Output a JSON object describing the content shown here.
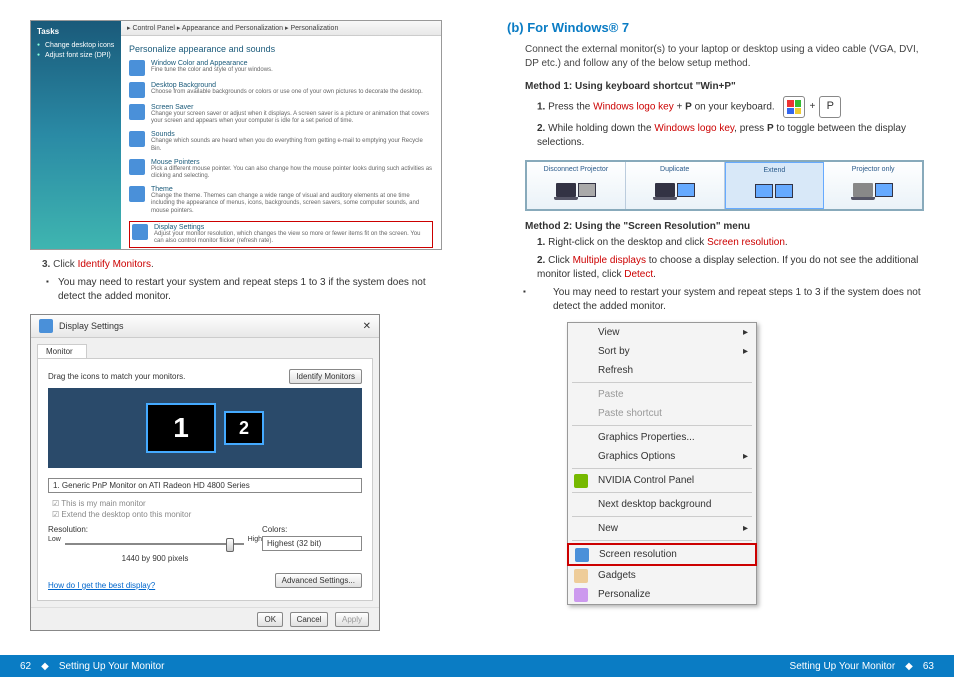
{
  "pages": {
    "left_num": "62",
    "right_num": "63",
    "section": "Setting Up Your Monitor"
  },
  "left": {
    "step3_label": "3.",
    "step3_pre": "Click ",
    "step3_link": "Identify Monitors",
    "step3_post": ".",
    "note": "You may need to restart your system and repeat steps 1 to 3 if the system does not detect the added monitor."
  },
  "cpanel": {
    "crumb": "▸ Control Panel ▸ Appearance and Personalization ▸ Personalization",
    "tasks_title": "Tasks",
    "tasks": [
      "Change desktop icons",
      "Adjust font size (DPI)"
    ],
    "heading": "Personalize appearance and sounds",
    "items": [
      {
        "t": "Window Color and Appearance",
        "s": "Fine tune the color and style of your windows."
      },
      {
        "t": "Desktop Background",
        "s": "Choose from available backgrounds or colors or use one of your own pictures to decorate the desktop."
      },
      {
        "t": "Screen Saver",
        "s": "Change your screen saver or adjust when it displays. A screen saver is a picture or animation that covers your screen and appears when your computer is idle for a set period of time."
      },
      {
        "t": "Sounds",
        "s": "Change which sounds are heard when you do everything from getting e-mail to emptying your Recycle Bin."
      },
      {
        "t": "Mouse Pointers",
        "s": "Pick a different mouse pointer. You can also change how the mouse pointer looks during such activities as clicking and selecting."
      },
      {
        "t": "Theme",
        "s": "Change the theme. Themes can change a wide range of visual and auditory elements at one time including the appearance of menus, icons, backgrounds, screen savers, some computer sounds, and mouse pointers."
      },
      {
        "t": "Display Settings",
        "s": "Adjust your monitor resolution, which changes the view so more or fewer items fit on the screen. You can also control monitor flicker (refresh rate)."
      }
    ]
  },
  "dialog": {
    "title": "Display Settings",
    "tab": "Monitor",
    "instr": "Drag the icons to match your monitors.",
    "identify_btn": "Identify Monitors",
    "mon1": "1",
    "mon2": "2",
    "dropdown": "1. Generic PnP Monitor on ATI Radeon HD 4800 Series",
    "chk1": "This is my main monitor",
    "chk2": "Extend the desktop onto this monitor",
    "res_label": "Resolution:",
    "low": "Low",
    "high": "High",
    "res_val": "1440 by 900 pixels",
    "colors_label": "Colors:",
    "colors_val": "Highest (32 bit)",
    "help_link": "How do I get the best display?",
    "adv_btn": "Advanced Settings...",
    "ok": "OK",
    "cancel": "Cancel",
    "apply": "Apply"
  },
  "right": {
    "prefix": "(b)",
    "heading": "For Windows® 7",
    "intro": "Connect the external monitor(s) to your laptop or desktop using a video cable (VGA, DVI, DP etc.) and follow any of the below setup method.",
    "m1_title": "Method 1: Using keyboard shortcut \"Win+P\"",
    "m1_1a": "Press the ",
    "m1_1b": "Windows logo key",
    "m1_1c": " + ",
    "m1_1d": "P",
    "m1_1e": " on your keyboard.",
    "m1_2a": "While holding down the ",
    "m1_2b": "Windows logo key",
    "m1_2c": ", press ",
    "m1_2d": "P",
    "m1_2e": " to toggle between the display selections.",
    "proj": [
      "Disconnect Projector",
      "Duplicate",
      "Extend",
      "Projector only"
    ],
    "m2_title": "Method 2: Using the \"Screen Resolution\" menu",
    "m2_1a": "Right-click on the desktop and click ",
    "m2_1b": "Screen resolution",
    "m2_1c": ".",
    "m2_2a": "Click ",
    "m2_2b": "Multiple displays",
    "m2_2c": " to choose a display selection. If you do not see the additional monitor listed, click ",
    "m2_2d": "Detect",
    "m2_2e": ".",
    "m2_note": "You may need to restart your system and repeat steps 1 to 3 if the system does not detect the added monitor."
  },
  "ctx": {
    "view": "View",
    "sort": "Sort by",
    "refresh": "Refresh",
    "paste": "Paste",
    "paste_sc": "Paste shortcut",
    "gprop": "Graphics Properties...",
    "gopt": "Graphics Options",
    "nvidia": "NVIDIA Control Panel",
    "nextbg": "Next desktop background",
    "new": "New",
    "scres": "Screen resolution",
    "gadgets": "Gadgets",
    "pers": "Personalize"
  },
  "key_p": "P"
}
